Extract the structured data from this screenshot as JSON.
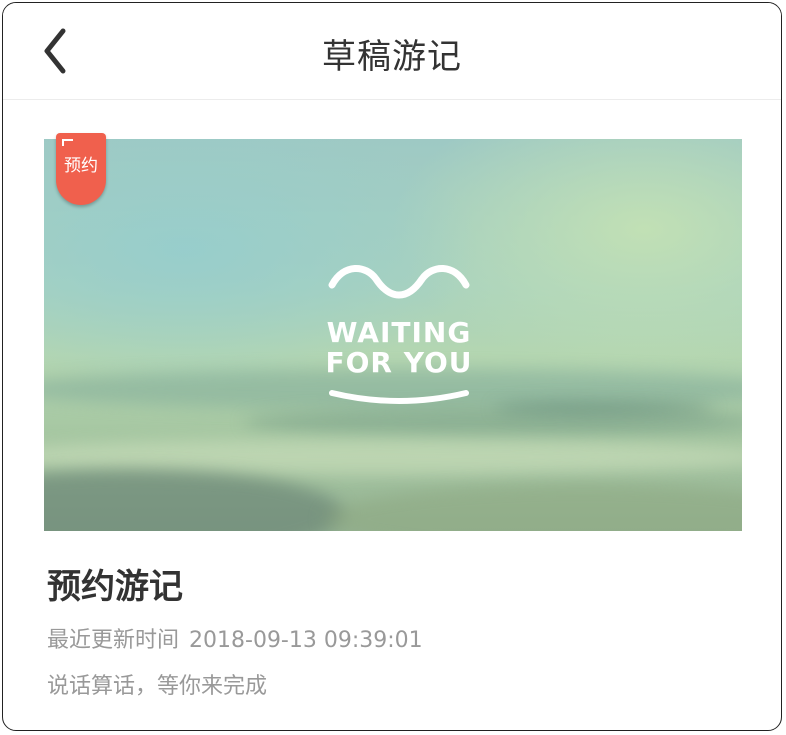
{
  "navbar": {
    "title": "草稿游记",
    "back_icon": "chevron-left-icon"
  },
  "draft": {
    "badge_label": "预约",
    "badge_color": "#f0604d",
    "cover_logo_line1": "WAITING",
    "cover_logo_line2": "FOR YOU",
    "title": "预约游记",
    "updated_label": "最近更新时间",
    "updated_time": "2018-09-13 09:39:01",
    "subtitle": "说话算话，等你来完成"
  },
  "colors": {
    "title_text": "#333333",
    "secondary_text": "#999999",
    "divider": "#ececec"
  }
}
